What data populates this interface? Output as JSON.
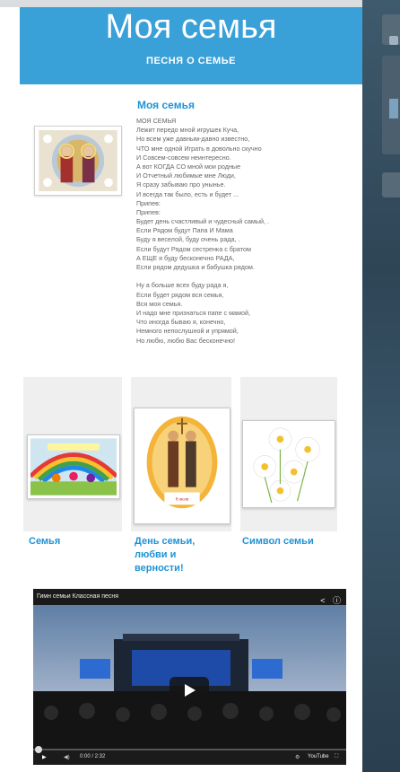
{
  "header": {
    "title": "Моя семья",
    "subtitle": "ПЕСНЯ О СЕМЬЕ"
  },
  "post": {
    "title": "Моя семья",
    "lines": [
      "МОЯ СЕМЬЯ",
      "Лежит передо мной игрушек Куча,",
      "Но всем уже давным-давно известно,",
      "ЧТО мне одной Играть в довольно скучно",
      "И Совсем-совсем неинтересно.",
      "А вот КОГДА СО мной мои родные",
      "И Отчетный любимые мне Люди,",
      "Я сразу забываю про унынье.",
      "И всегда так было, есть и будет ...",
      "Припев:",
      "Припев:",
      "Будет день счастливый и чудесный самый, .",
      "Если Рядом будут Папа И Мама",
      "Буду я веселой, буду очень рада, .",
      "Если будут Рядом сестренка с братом",
      "А ЕЩЕ я буду бесконечно РАДА,",
      "Если рядом дедушка и бабушка рядом.",
      "",
      "Ну а больше всех буду рада я,",
      "Если будет рядом вся семья,",
      "Вся моя семья.",
      "И надо мне признаться папе с мамой,",
      "Что иногда бываю я, конечно,",
      "Немного непослушной и упрямой,",
      "Но любю, любю Вас бесконечно!"
    ]
  },
  "gallery": [
    {
      "label_lines": [
        "Семья"
      ]
    },
    {
      "label_lines": [
        "День семьи,",
        "любви и",
        "верности!"
      ]
    },
    {
      "label_lines": [
        "Символ семьи"
      ]
    }
  ],
  "video": {
    "title": "Гимн семьи Классная песня",
    "time": "0:00 / 2:32",
    "share_icon": "share-icon",
    "info_icon": "info-icon",
    "play_icon": "play-icon"
  },
  "colors": {
    "accent": "#39a0d8",
    "link": "#1f93d4",
    "sidebar": "#2e4556"
  }
}
